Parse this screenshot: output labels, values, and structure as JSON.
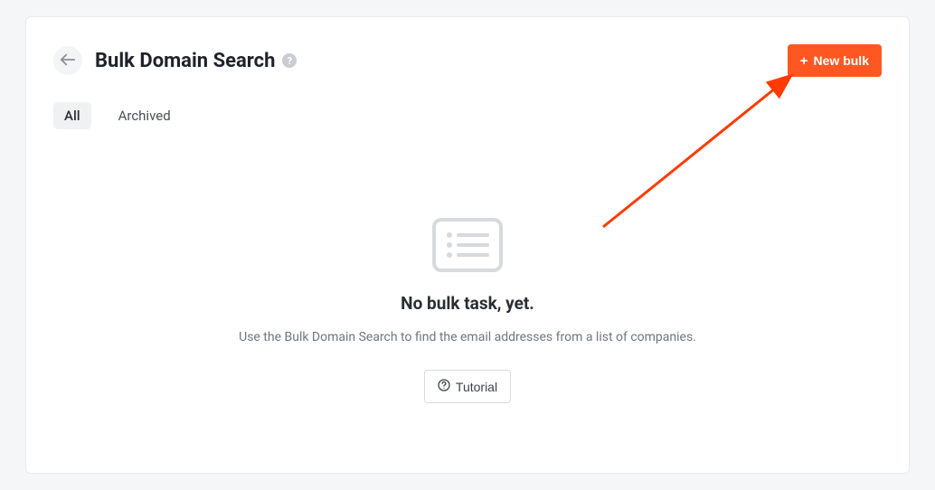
{
  "header": {
    "title": "Bulk Domain Search",
    "new_bulk_label": "New bulk"
  },
  "tabs": {
    "all": "All",
    "archived": "Archived"
  },
  "empty": {
    "title": "No bulk task, yet.",
    "description": "Use the Bulk Domain Search to find the email addresses from a list of companies.",
    "tutorial_label": "Tutorial"
  }
}
